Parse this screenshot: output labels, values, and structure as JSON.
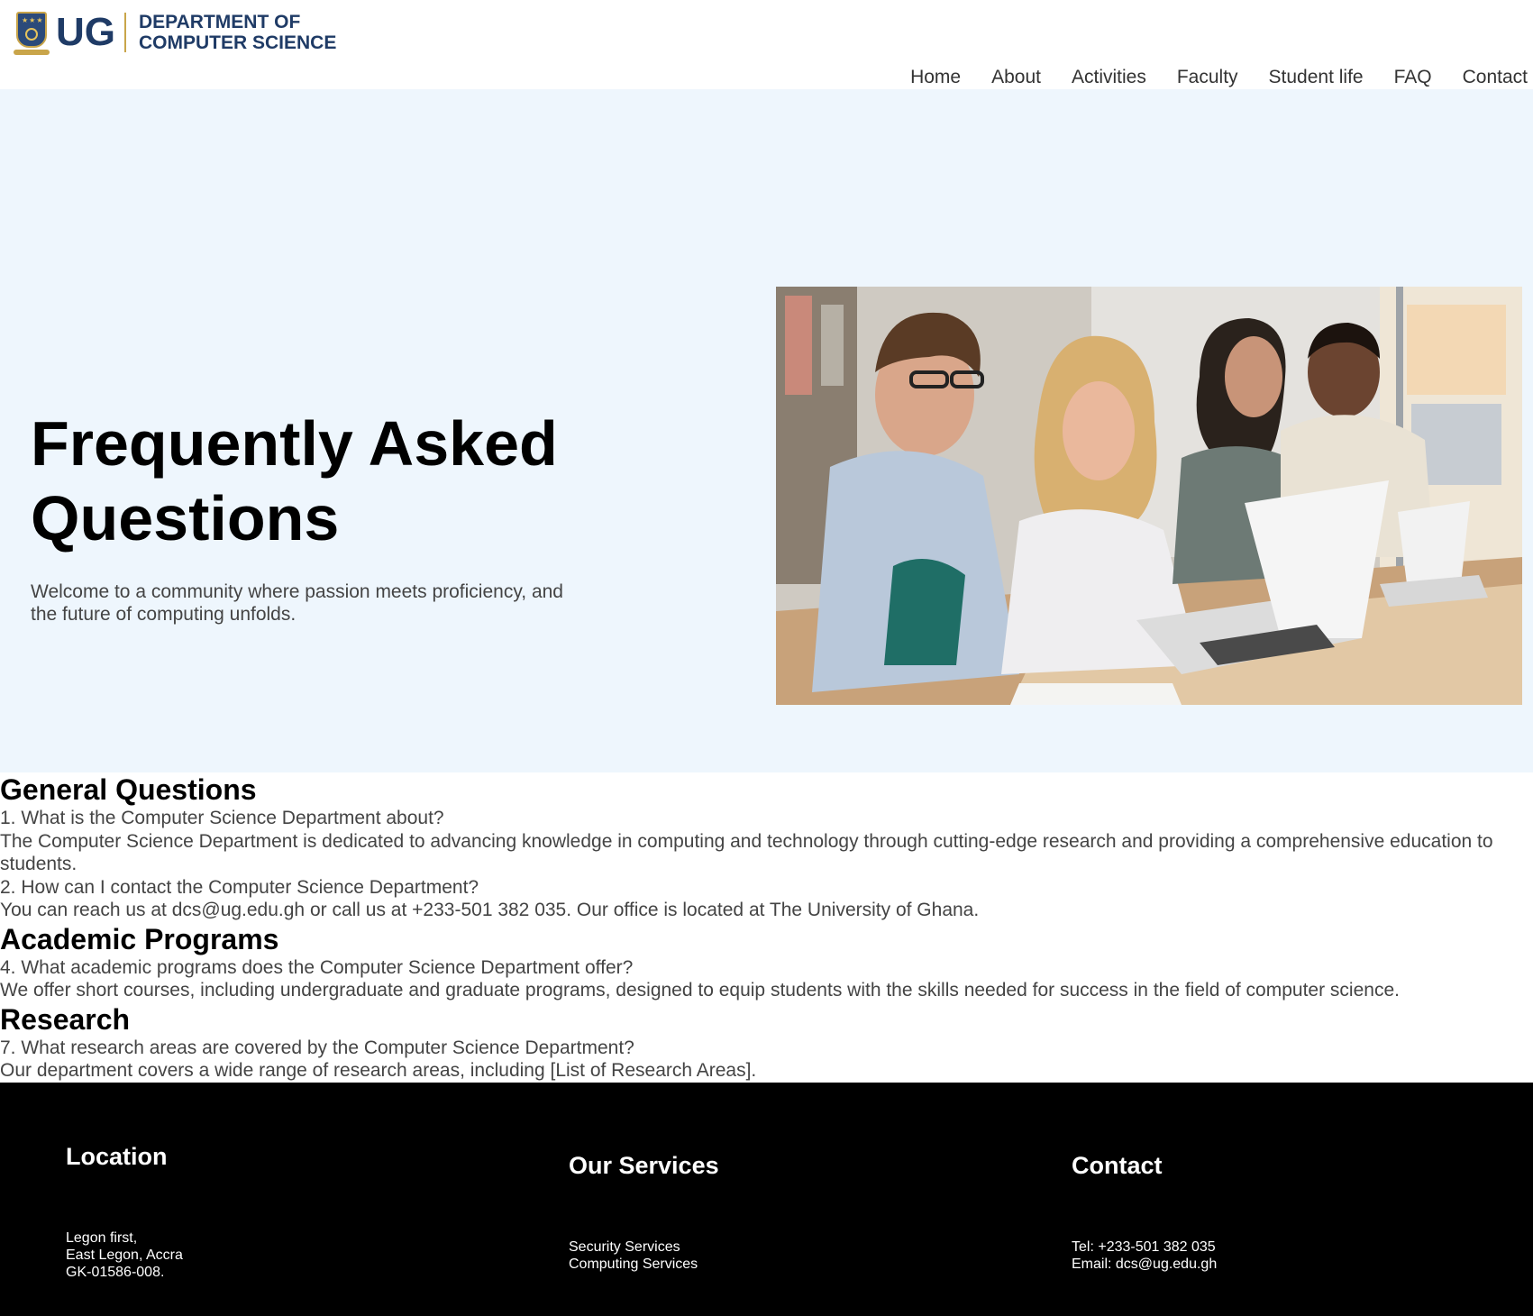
{
  "header": {
    "logo_abbrev": "UG",
    "dept_line1": "DEPARTMENT OF",
    "dept_line2": "COMPUTER SCIENCE",
    "nav": [
      "Home",
      "About",
      "Activities",
      "Faculty",
      "Student life",
      "FAQ",
      "Contact"
    ]
  },
  "hero": {
    "title": "Frequently Asked Questions",
    "subtitle": "Welcome to a community where passion meets proficiency, and the future of computing unfolds."
  },
  "faq": {
    "general": {
      "heading": "General Questions",
      "q1": "1. What is the Computer Science Department about?",
      "a1": "The Computer Science Department is dedicated to advancing knowledge in computing and technology through cutting-edge research and providing a comprehensive education to students.",
      "q2": "2. How can I contact the Computer Science Department?",
      "a2": "You can reach us at dcs@ug.edu.gh or call us at +233-501 382 035. Our office is located at The University of Ghana."
    },
    "academic": {
      "heading": "Academic Programs",
      "q4": "4. What academic programs does the Computer Science Department offer?",
      "a4": "We offer short courses, including undergraduate and graduate programs, designed to equip students with the skills needed for success in the field of computer science."
    },
    "research": {
      "heading": "Research",
      "q7": "7. What research areas are covered by the Computer Science Department?",
      "a7": "Our department covers a wide range of research areas, including [List of Research Areas]."
    }
  },
  "footer": {
    "location": {
      "heading": "Location",
      "lines": [
        "Legon first,",
        "East Legon, Accra",
        "GK-01586-008."
      ]
    },
    "services": {
      "heading": "Our Services",
      "lines": [
        "Security Services",
        "Computing Services"
      ]
    },
    "contact": {
      "heading": "Contact",
      "lines": [
        "Tel: +233-501 382 035",
        "Email: dcs@ug.edu.gh"
      ]
    }
  },
  "colors": {
    "brand": "#1f3b66",
    "hero_bg": "#eef6fd",
    "footer_bg": "#000000",
    "accent_gold": "#c9a54a"
  }
}
